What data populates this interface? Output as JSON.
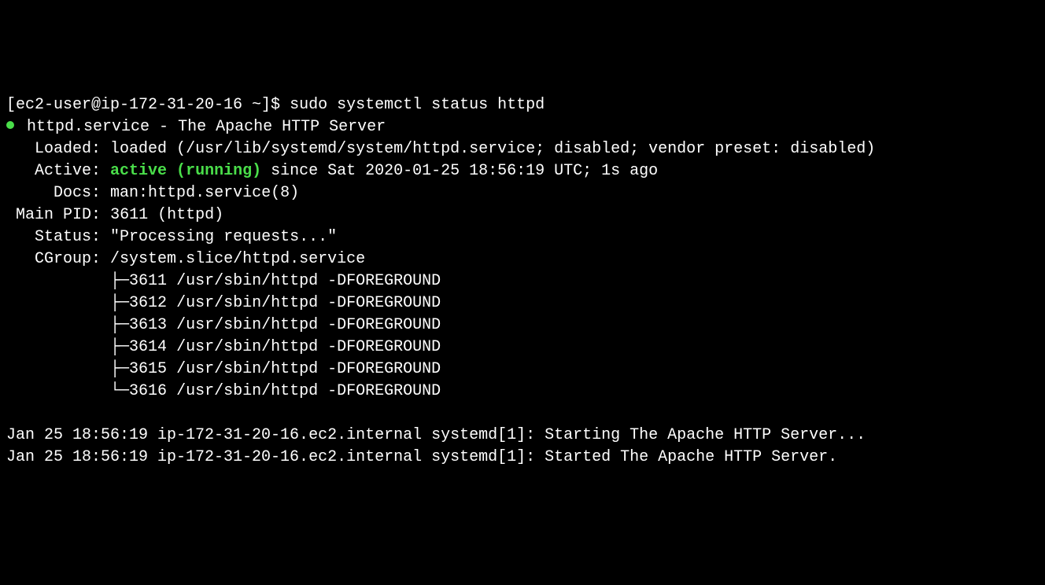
{
  "prompt": {
    "text": "[ec2-user@ip-172-31-20-16 ~]$ ",
    "command": "sudo systemctl status httpd"
  },
  "service": {
    "name": "httpd.service",
    "desc": "The Apache HTTP Server",
    "loaded": {
      "label": "Loaded:",
      "value": "loaded (/usr/lib/systemd/system/httpd.service; disabled; vendor preset: disabled)"
    },
    "active": {
      "label": "Active:",
      "status": "active (running)",
      "since": " since Sat 2020-01-25 18:56:19 UTC; 1s ago"
    },
    "docs": {
      "label": "Docs:",
      "value": "man:httpd.service(8)"
    },
    "mainpid": {
      "label": "Main PID:",
      "value": "3611 (httpd)"
    },
    "status": {
      "label": "Status:",
      "value": "\"Processing requests...\""
    },
    "cgroup": {
      "label": "CGroup:",
      "path": "/system.slice/httpd.service",
      "procs": [
        {
          "pid": "3611",
          "cmd": "/usr/sbin/httpd -DFOREGROUND"
        },
        {
          "pid": "3612",
          "cmd": "/usr/sbin/httpd -DFOREGROUND"
        },
        {
          "pid": "3613",
          "cmd": "/usr/sbin/httpd -DFOREGROUND"
        },
        {
          "pid": "3614",
          "cmd": "/usr/sbin/httpd -DFOREGROUND"
        },
        {
          "pid": "3615",
          "cmd": "/usr/sbin/httpd -DFOREGROUND"
        },
        {
          "pid": "3616",
          "cmd": "/usr/sbin/httpd -DFOREGROUND"
        }
      ]
    }
  },
  "log": [
    "Jan 25 18:56:19 ip-172-31-20-16.ec2.internal systemd[1]: Starting The Apache HTTP Server...",
    "Jan 25 18:56:19 ip-172-31-20-16.ec2.internal systemd[1]: Started The Apache HTTP Server."
  ]
}
